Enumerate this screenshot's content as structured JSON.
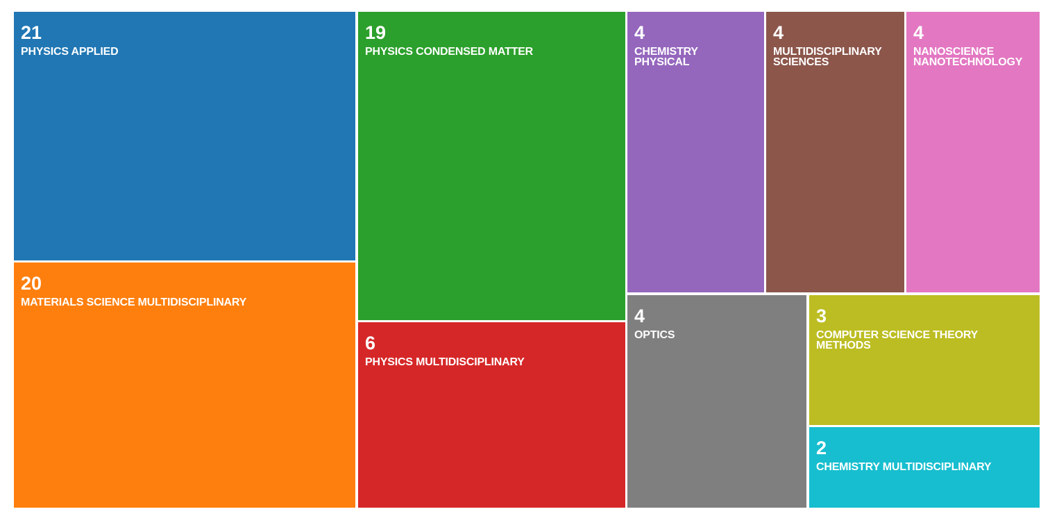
{
  "chart_data": {
    "type": "treemap",
    "items": [
      {
        "name": "PHYSICS APPLIED",
        "lines": [
          "PHYSICS APPLIED"
        ],
        "value": 21,
        "color": "#2077b4"
      },
      {
        "name": "MATERIALS SCIENCE MULTIDISCIPLINARY",
        "lines": [
          "MATERIALS SCIENCE MULTIDISCIPLINARY"
        ],
        "value": 20,
        "color": "#ff7f0e"
      },
      {
        "name": "PHYSICS CONDENSED MATTER",
        "lines": [
          "PHYSICS CONDENSED MATTER"
        ],
        "value": 19,
        "color": "#2ca02c"
      },
      {
        "name": "PHYSICS MULTIDISCIPLINARY",
        "lines": [
          "PHYSICS MULTIDISCIPLINARY"
        ],
        "value": 6,
        "color": "#d62728"
      },
      {
        "name": "CHEMISTRY PHYSICAL",
        "lines": [
          "CHEMISTRY",
          "PHYSICAL"
        ],
        "value": 4,
        "color": "#9467bd"
      },
      {
        "name": "MULTIDISCIPLINARY SCIENCES",
        "lines": [
          "MULTIDISCIPLINARY",
          "SCIENCES"
        ],
        "value": 4,
        "color": "#8c564b"
      },
      {
        "name": "NANOSCIENCE NANOTECHNOLOGY",
        "lines": [
          "NANOSCIENCE",
          "NANOTECHNOLOGY"
        ],
        "value": 4,
        "color": "#e377c2"
      },
      {
        "name": "OPTICS",
        "lines": [
          "OPTICS"
        ],
        "value": 4,
        "color": "#7f7f7f"
      },
      {
        "name": "COMPUTER SCIENCE THEORY METHODS",
        "lines": [
          "COMPUTER SCIENCE THEORY",
          "METHODS"
        ],
        "value": 3,
        "color": "#bcbd22"
      },
      {
        "name": "CHEMISTRY MULTIDISCIPLINARY",
        "lines": [
          "CHEMISTRY MULTIDISCIPLINARY"
        ],
        "value": 2,
        "color": "#17becf"
      }
    ]
  }
}
